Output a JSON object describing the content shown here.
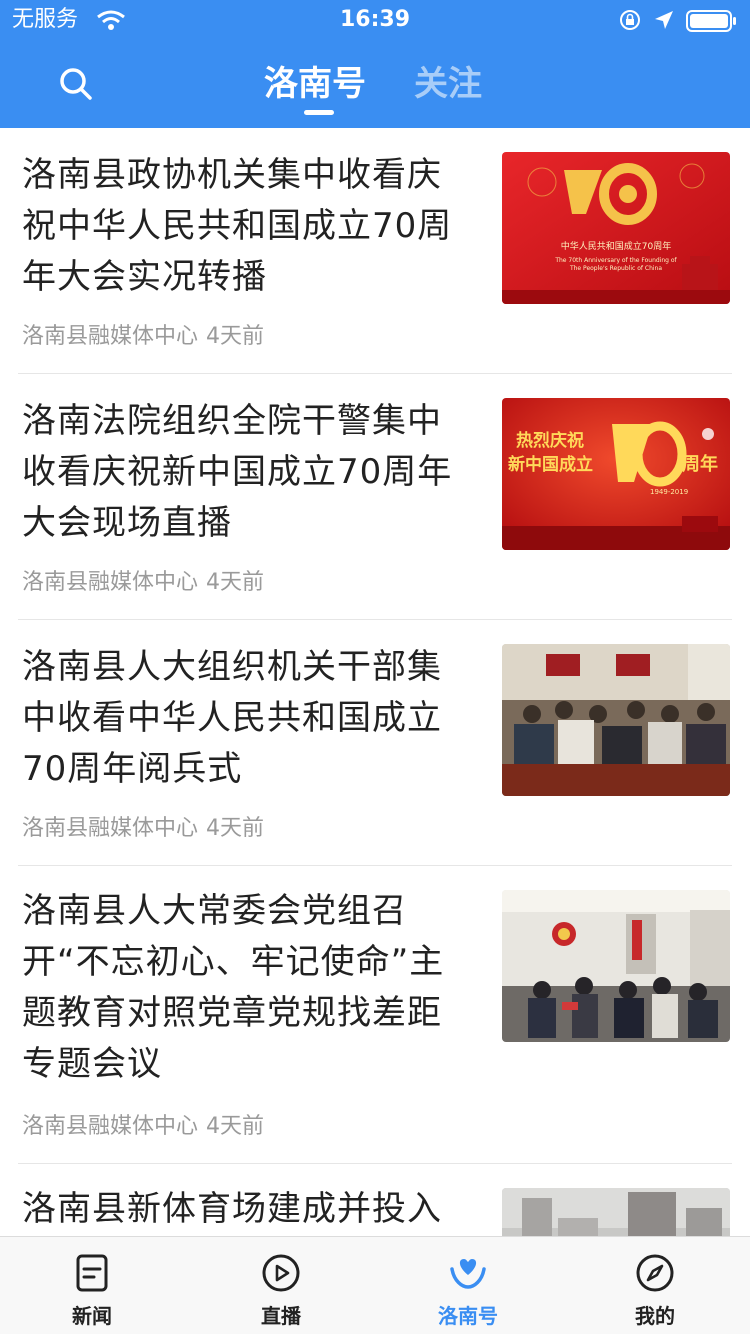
{
  "status_bar": {
    "carrier": "无服务",
    "time": "16:39"
  },
  "header": {
    "search_icon": "search-icon",
    "tabs": [
      {
        "label": "洛南号",
        "active": true
      },
      {
        "label": "关注",
        "active": false
      }
    ]
  },
  "feed": {
    "items": [
      {
        "title": "洛南县政协机关集中收看庆祝中华人民共和国成立70周年大会实况转播",
        "source": "洛南县融媒体中心",
        "time": "4天前",
        "thumb_text": {
          "headline": "中华人民共和国成立70周年",
          "sub1": "The 70th Anniversary of the Founding of",
          "sub2": "The People's Republic of China"
        }
      },
      {
        "title": "洛南法院组织全院干警集中收看庆祝新中国成立70周年大会现场直播",
        "source": "洛南县融媒体中心",
        "time": "4天前",
        "thumb_text": {
          "left": "热烈庆祝\n新中国成立",
          "right": "周年",
          "years": "1949-2019"
        }
      },
      {
        "title": "洛南县人大组织机关干部集中收看中华人民共和国成立70周年阅兵式",
        "source": "洛南县融媒体中心",
        "time": "4天前"
      },
      {
        "title": "洛南县人大常委会党组召开“不忘初心、牢记使命”主题教育对照党章党规找差距专题会议",
        "source": "洛南县融媒体中心",
        "time": "4天前"
      },
      {
        "title": "洛南县新体育场建成并投入"
      }
    ]
  },
  "tabbar": {
    "items": [
      {
        "label": "新闻",
        "icon": "news-icon",
        "active": false
      },
      {
        "label": "直播",
        "icon": "play-icon",
        "active": false
      },
      {
        "label": "洛南号",
        "icon": "heart-hands-icon",
        "active": true
      },
      {
        "label": "我的",
        "icon": "compass-icon",
        "active": false
      }
    ]
  },
  "colors": {
    "primary": "#3a8ef2",
    "red": "#d6161c",
    "gold": "#f5c24a"
  }
}
